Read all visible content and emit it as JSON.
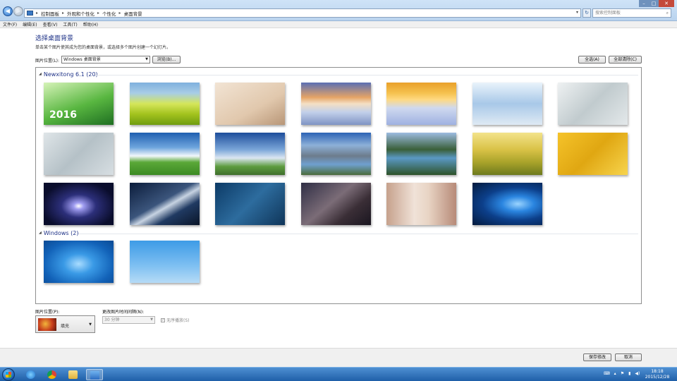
{
  "address": {
    "crumbs": [
      "控制面板",
      "外观和个性化",
      "个性化",
      "桌面背景"
    ],
    "search_placeholder": "搜索控制面板"
  },
  "menu": [
    "文件(F)",
    "编辑(E)",
    "查看(V)",
    "工具(T)",
    "帮助(H)"
  ],
  "page": {
    "title": "选择桌面背景",
    "subtitle": "单击某个图片使其成为您的桌面背景，或选择多个图片创建一个幻灯片。",
    "location_label": "图片位置(L):",
    "location_value": "Windows 桌面背景",
    "browse_label": "浏览(B)...",
    "select_all_label": "全选(A)",
    "clear_all_label": "全部清除(C)"
  },
  "groups": [
    {
      "title": "Newxitong 6.1 (20)",
      "thumbs": [
        {
          "name": "green-2016",
          "overlay": "2016",
          "bg": "linear-gradient(160deg,#d6f3b8,#58b640 55%,#1f6f22)"
        },
        {
          "name": "rapeseed-field",
          "overlay": "",
          "bg": "linear-gradient(#7fb0de 0%,#a8cde6 25%,#d5e65a 50%,#a2c21d 75%,#6f9c10)"
        },
        {
          "name": "desert-figure",
          "overlay": "",
          "bg": "linear-gradient(150deg,#f2e4d4,#e1c8ad 60%,#b89677)"
        },
        {
          "name": "snow-sunset",
          "overlay": "",
          "bg": "linear-gradient(#5b6fb3 0%,#e5a466 35%,#f4dfc3 50%,#c2d0ea 70%,#7f94c4)"
        },
        {
          "name": "snow-sunrise",
          "overlay": "",
          "bg": "linear-gradient(#e9a02a 0%,#f5c24f 25%,#ffd981 40%,#cfd9ef 60%,#9fb1e1)"
        },
        {
          "name": "frost-tree",
          "overlay": "",
          "bg": "linear-gradient(#e9f3fb,#a8c8e8 50%,#dfeaf4)"
        },
        {
          "name": "frost-leaf",
          "overlay": "",
          "bg": "linear-gradient(135deg,#eef1f2,#c1cbce 50%,#e3e8ea)"
        },
        {
          "name": "frost-feather",
          "overlay": "",
          "bg": "linear-gradient(135deg,#dfe5e8,#b5c1c7 50%,#d7dee2)"
        },
        {
          "name": "blue-sky-field",
          "overlay": "",
          "bg": "linear-gradient(#1f5fb0 0%,#6ea5dd 35%,#f2f7fb 55%,#5aa838 70%,#3c8a23)"
        },
        {
          "name": "windmill-coast",
          "overlay": "",
          "bg": "linear-gradient(#1d4d9b 0%,#7aa5d8 40%,#dbe6f1 60%,#5d9c3f 80%,#3f6f2c)"
        },
        {
          "name": "mountain-lake",
          "overlay": "",
          "bg": "linear-gradient(#2c63b5 0%,#8db0d8 30%,#6d7c8c 55%,#6fa0cf 75%,#4a6b3a)"
        },
        {
          "name": "green-lake",
          "overlay": "",
          "bg": "linear-gradient(#9cbbe0 0%,#3a5f38 40%,#5a98c4 60%,#2e5329)"
        },
        {
          "name": "yellow-hills",
          "overlay": "",
          "bg": "linear-gradient(#f3e38a 0%,#d9c247 40%,#a9a32a 70%,#6d7a1e)"
        },
        {
          "name": "golden-leaves",
          "overlay": "",
          "bg": "linear-gradient(135deg,#f5c32a,#e0a712 50%,#f7d44d)"
        },
        {
          "name": "galaxy-spiral",
          "overlay": "",
          "bg": "radial-gradient(ellipse at 50% 55%,#ffffff 0%,#9f9cf0 10%,#2c2f7a 35%,#0a0d2c 75%)"
        },
        {
          "name": "galaxy-andromeda",
          "overlay": "",
          "bg": "linear-gradient(150deg,#0b1c3b 0%,#3b557c 45%,#c7d3e2 55%,#203a62 70%,#0a1528)"
        },
        {
          "name": "blue-nebula",
          "overlay": "",
          "bg": "linear-gradient(135deg,#0c3a66,#2d6c9e 50%,#0f3559)"
        },
        {
          "name": "milky-way",
          "overlay": "",
          "bg": "linear-gradient(140deg,#2f2e45,#7b6c77 45%,#3a2e36 70%,#1a1620)"
        },
        {
          "name": "girl-portrait",
          "overlay": "",
          "bg": "linear-gradient(90deg,#c6a18c,#f0e2d8 40%,#e8d4c4 60%,#b78a78)"
        },
        {
          "name": "windows-10",
          "overlay": "",
          "bg": "radial-gradient(ellipse at 65% 50%,#9ad4ff 0%,#2a85e0 25%,#0c3f8a 55%,#041a3d)"
        }
      ]
    },
    {
      "title": "Windows (2)",
      "thumbs": [
        {
          "name": "windows-7",
          "overlay": "",
          "bg": "radial-gradient(ellipse at 50% 55%,#a9dcff 0%,#3a9ae6 30%,#1262b8 70%,#0b4a94)"
        },
        {
          "name": "daisies",
          "overlay": "",
          "bg": "linear-gradient(#3d9be6,#7fc0f2 60%,#b6dbf6)"
        }
      ]
    }
  ],
  "options": {
    "position_label": "图片位置(P):",
    "position_value": "填充",
    "interval_label": "更改图片时间间隔(N):",
    "interval_value": "30 分钟",
    "shuffle_label": "无序播放(S)",
    "shuffle_mark": "✓"
  },
  "footer": {
    "save_label": "保存修改",
    "cancel_label": "取消"
  },
  "taskbar": {
    "time": "18:18",
    "date": "2015/12/28"
  }
}
